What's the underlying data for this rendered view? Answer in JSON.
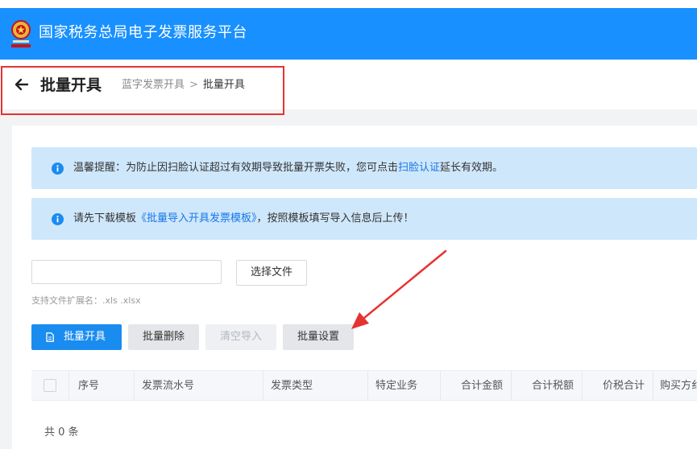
{
  "header": {
    "app_title": "国家税务总局电子发票服务平台",
    "logo_icon": "tax-emblem-icon",
    "color": "#1890ff"
  },
  "page": {
    "title": "批量开具",
    "breadcrumb": [
      "蓝字发票开具",
      "批量开具"
    ],
    "breadcrumb_separator": ">"
  },
  "alerts": [
    {
      "prefix": "温馨提醒：为防止因扫脸认证超过有效期导致批量开票失败，您可点击",
      "link": "扫脸认证",
      "suffix": "延长有效期。"
    },
    {
      "prefix": "请先下载模板",
      "link": "《批量导入开具发票模板》",
      "suffix": "，按照模板填写导入信息后上传！"
    }
  ],
  "upload": {
    "file_value": "",
    "choose_label": "选择文件",
    "hint": "支持文件扩展名：.xls .xlsx"
  },
  "toolbar": {
    "issue_label": "批量开具",
    "delete_label": "批量删除",
    "clear_label": "清空导入",
    "settings_label": "批量设置"
  },
  "table": {
    "columns": [
      "序号",
      "发票流水号",
      "发票类型",
      "特定业务",
      "合计金额",
      "合计税额",
      "价税合计",
      "购买方纟"
    ]
  },
  "footer": {
    "total": "共 0 条"
  },
  "colors": {
    "primary": "#1a8cf0",
    "alert_bg": "#cfe7fb",
    "highlight": "#e63232"
  }
}
